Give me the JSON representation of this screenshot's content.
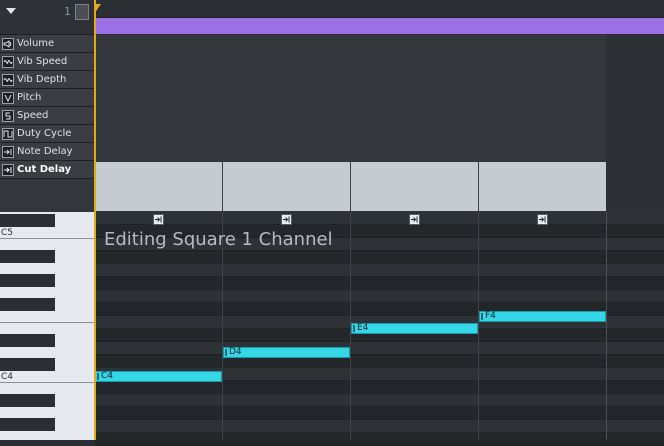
{
  "header": {
    "channel_number": "1"
  },
  "effects": [
    {
      "label": "Volume",
      "icon": "volume-icon"
    },
    {
      "label": "Vib Speed",
      "icon": "wave-icon"
    },
    {
      "label": "Vib Depth",
      "icon": "wave-icon"
    },
    {
      "label": "Pitch",
      "icon": "pitch-icon"
    },
    {
      "label": "Speed",
      "icon": "speed-icon"
    },
    {
      "label": "Duty Cycle",
      "icon": "duty-cycle-icon"
    },
    {
      "label": "Note Delay",
      "icon": "note-delay-icon"
    },
    {
      "label": "Cut Delay",
      "icon": "cut-delay-icon",
      "active": true
    }
  ],
  "envelope_values": [
    "9",
    "9",
    "9",
    "9"
  ],
  "piano": {
    "c5": "C5",
    "c4": "C4"
  },
  "notes": [
    {
      "label": "C4"
    },
    {
      "label": "D4"
    },
    {
      "label": "E4"
    },
    {
      "label": "F4"
    }
  ],
  "status": {
    "editing": "Editing Square 1 Channel"
  },
  "colors": {
    "accent": "#9a72e6",
    "note": "#35d6e6",
    "playhead": "#e6a817"
  }
}
